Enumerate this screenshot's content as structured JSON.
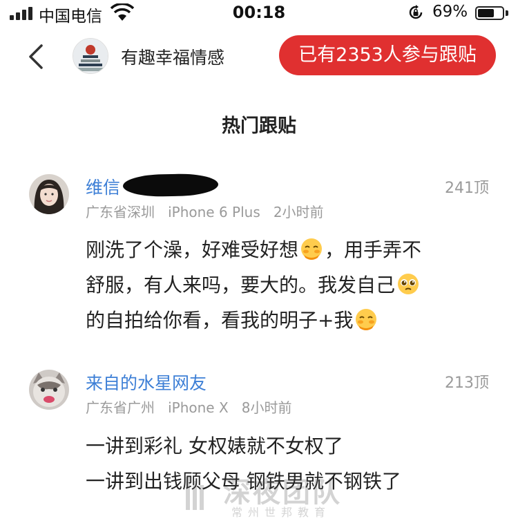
{
  "status_bar": {
    "carrier": "中国电信",
    "time": "00:18",
    "battery_percent": "69%",
    "battery_level": 0.69
  },
  "nav": {
    "channel_name": "有趣幸福情感",
    "join_button": "已有2353人参与跟贴"
  },
  "section_title": "热门跟贴",
  "comments": [
    {
      "username": "维信",
      "likes": "241顶",
      "location": "广东省深圳",
      "device": "iPhone 6 Plus",
      "time_ago": "2小时前",
      "text_1": "刚洗了个澡，好难受好想",
      "text_2": "，用手弄不",
      "text_3": "舒服，有人来吗，要大的。我发自己",
      "text_4": "的自拍给你看，看我的明子+我"
    },
    {
      "username": "来自的水星网友",
      "likes": "213顶",
      "location": "广东省广州",
      "device": "iPhone X",
      "time_ago": "8小时前",
      "line_1": "一讲到彩礼 女权婊就不女权了",
      "line_2": "一讲到出钱顾父母 钢铁男就不钢铁了"
    }
  ],
  "watermark": {
    "title": "深夜团队",
    "subtitle": "常州世邦教育"
  }
}
